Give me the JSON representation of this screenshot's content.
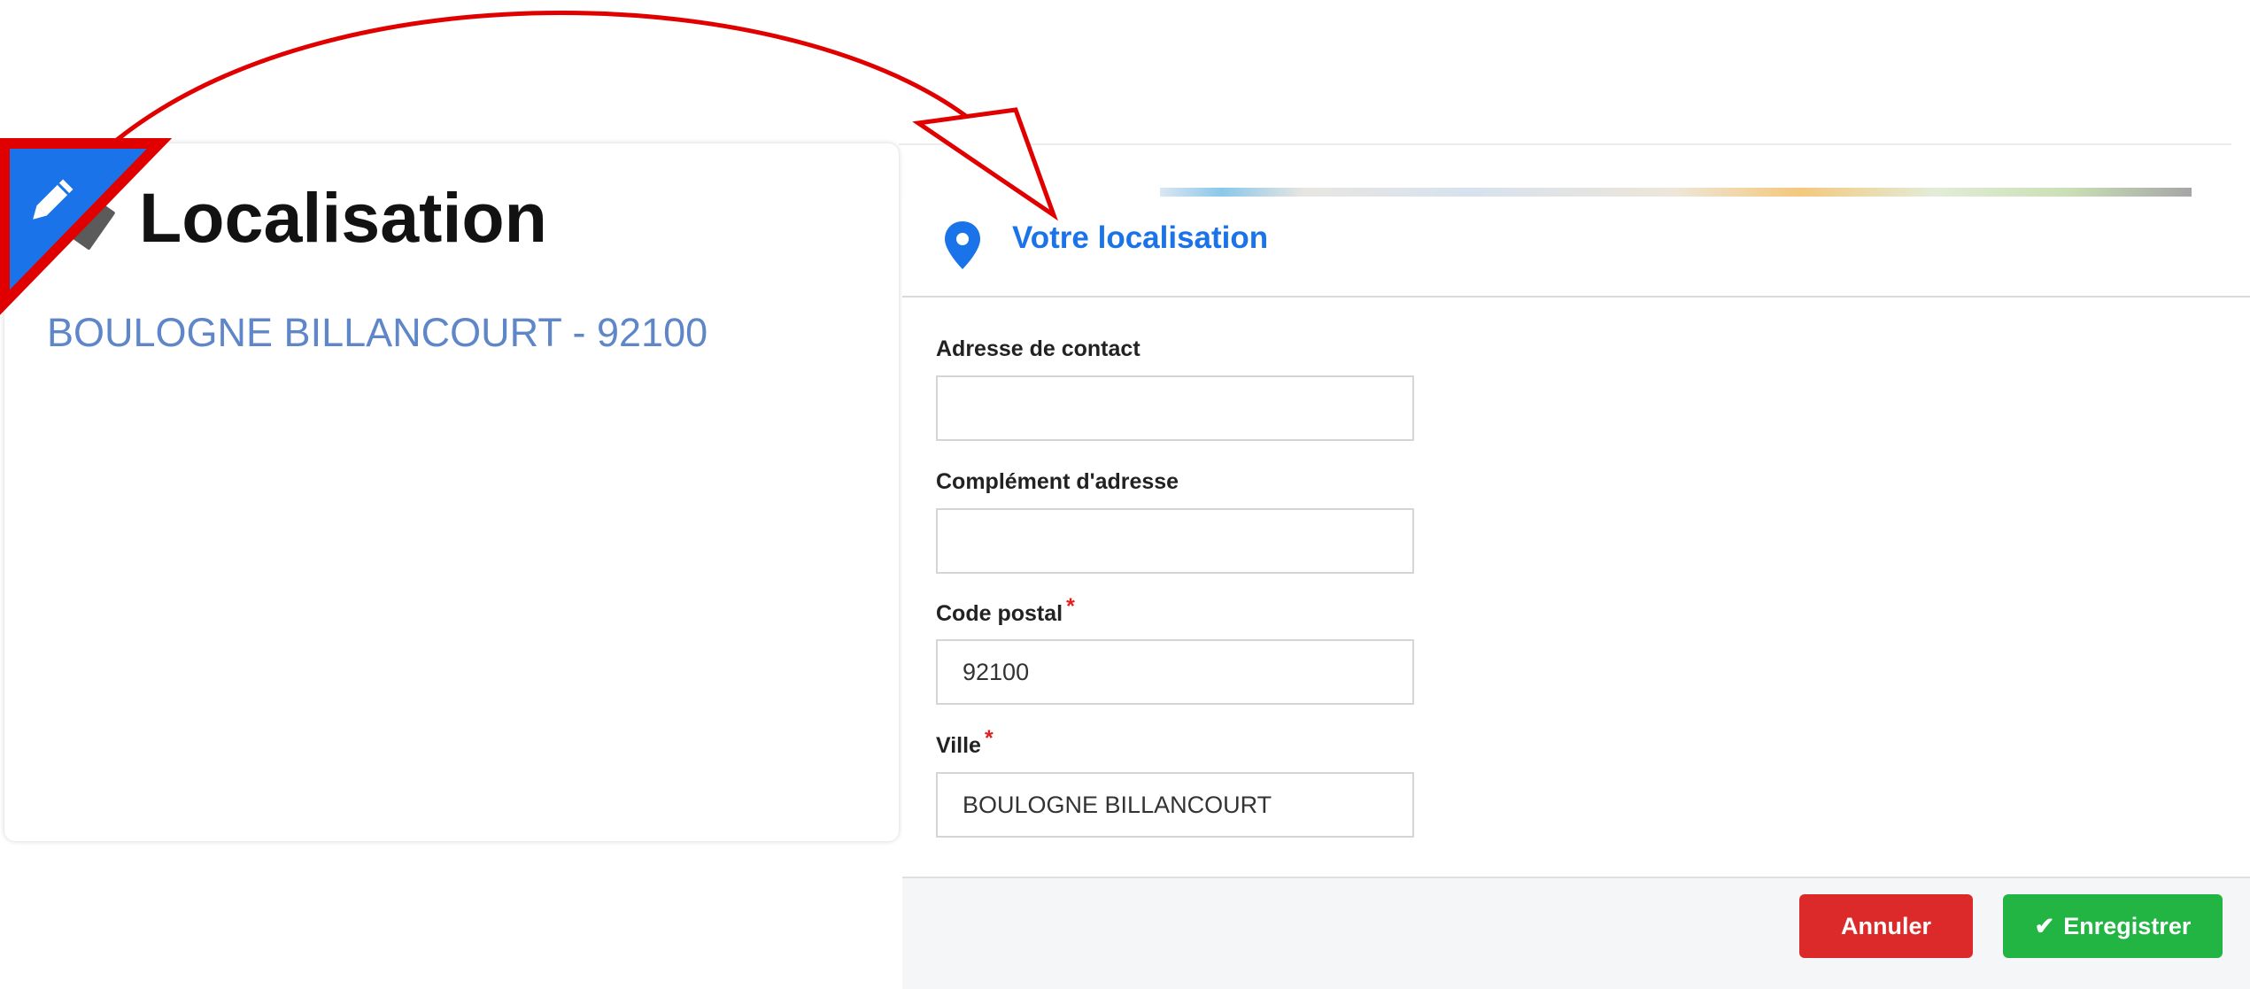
{
  "card": {
    "title": "Localisation",
    "city_line": "BOULOGNE BILLANCOURT - 92100",
    "edit_icon": "pencil-icon"
  },
  "dialog": {
    "title": "Votre localisation",
    "title_icon": "map-pin-icon",
    "fields": [
      {
        "label": "Adresse de contact",
        "value": "",
        "required": false
      },
      {
        "label": "Complément d'adresse",
        "value": "",
        "required": false
      },
      {
        "label": "Code postal",
        "value": "92100",
        "required": true
      },
      {
        "label": "Ville",
        "value": "BOULOGNE BILLANCOURT",
        "required": true
      }
    ],
    "required_marker": "*",
    "cancel_label": "Annuler",
    "save_label": "Enregistrer",
    "save_icon": "check-icon"
  },
  "colors": {
    "accent": "#1a73e8",
    "city_text": "#5e86c8",
    "cancel": "#dc2a2a",
    "save": "#22b543",
    "annotation": "#e00000"
  }
}
